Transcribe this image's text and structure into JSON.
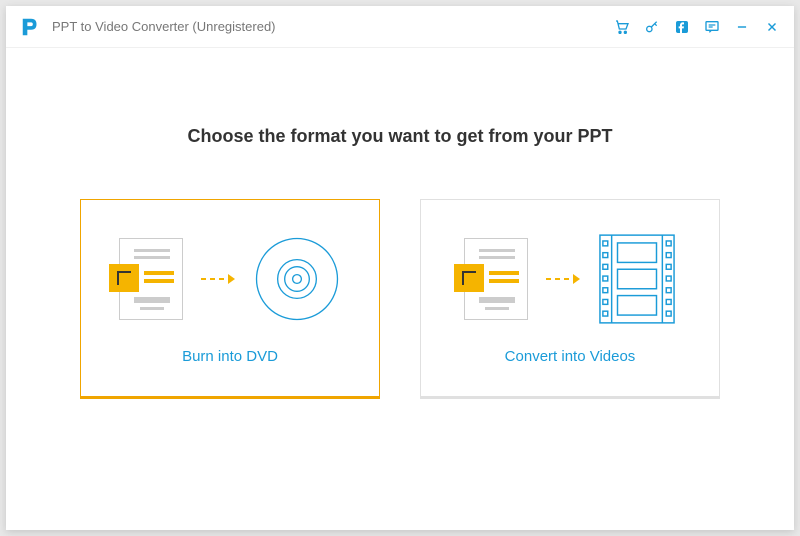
{
  "window": {
    "title": "PPT to Video Converter (Unregistered)"
  },
  "titlebar_icons": {
    "cart": "shopping-cart-icon",
    "key": "key-icon",
    "facebook": "facebook-icon",
    "feedback": "feedback-icon",
    "minimize": "minimize-icon",
    "close": "close-icon"
  },
  "main": {
    "heading": "Choose the format you want to get from your PPT",
    "options": {
      "dvd": {
        "label": "Burn into DVD"
      },
      "video": {
        "label": "Convert into Videos"
      }
    }
  },
  "colors": {
    "accent_blue": "#1a9bd8",
    "accent_orange": "#f5b400"
  }
}
